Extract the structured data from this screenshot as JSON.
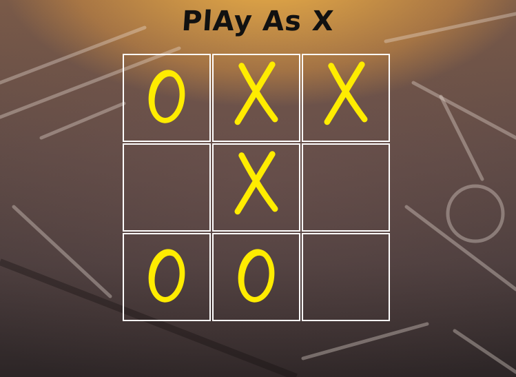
{
  "game": {
    "title": "PlAy As X",
    "player": "X"
  },
  "colors": {
    "mark": "#ffec00",
    "grid": "#ffffff",
    "title": "#111111"
  },
  "board": {
    "cells": [
      {
        "mark": "O"
      },
      {
        "mark": "X"
      },
      {
        "mark": "X"
      },
      {
        "mark": ""
      },
      {
        "mark": "X"
      },
      {
        "mark": ""
      },
      {
        "mark": "O"
      },
      {
        "mark": "O"
      },
      {
        "mark": ""
      }
    ]
  }
}
